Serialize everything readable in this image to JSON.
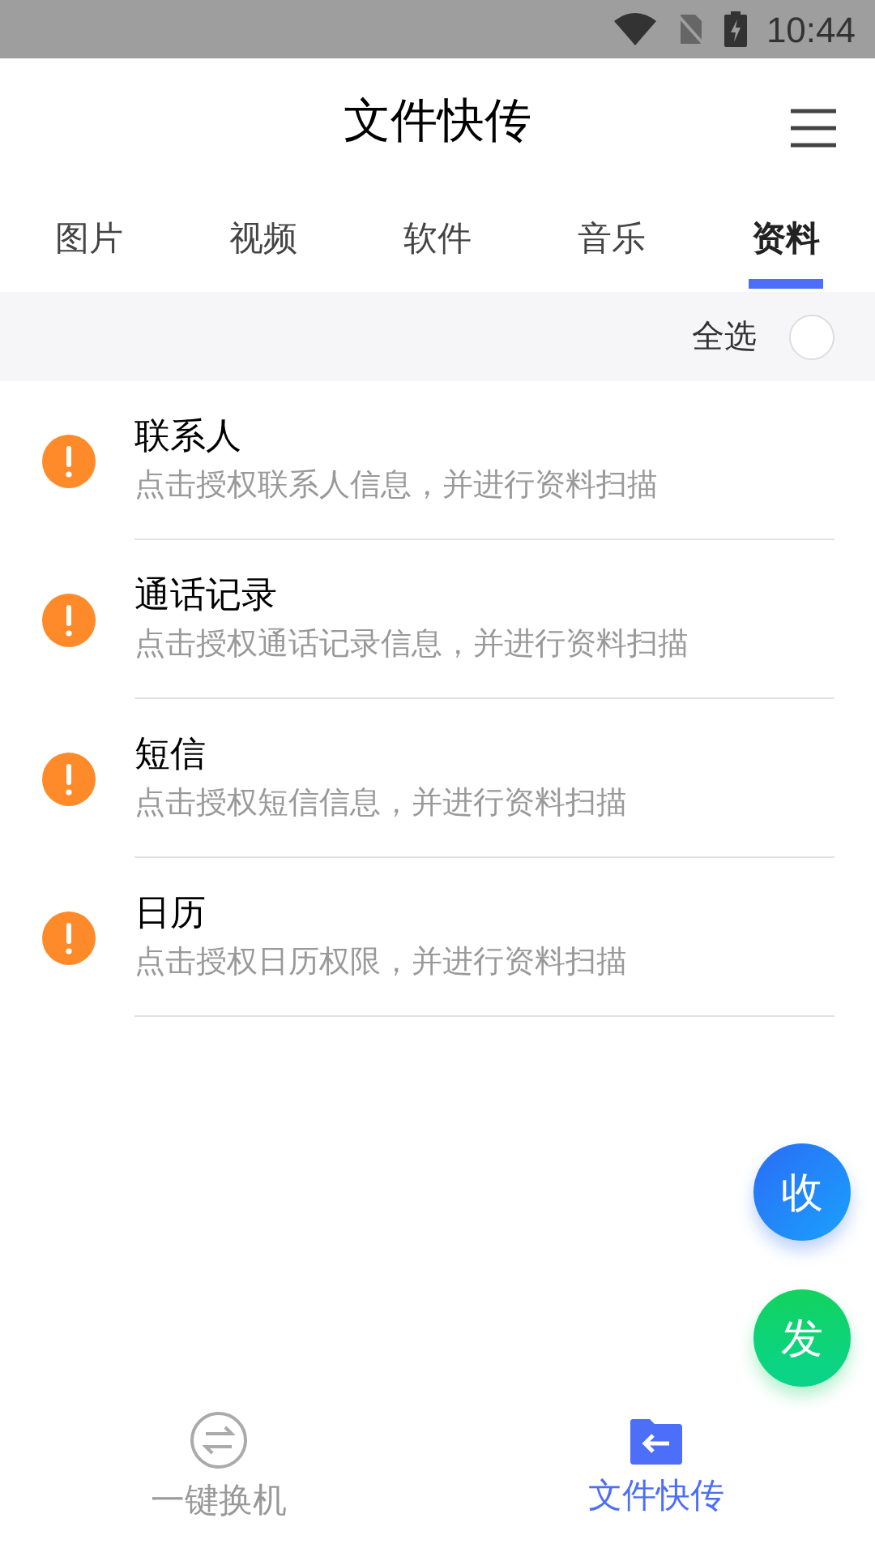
{
  "status_bar": {
    "time": "10:44"
  },
  "header": {
    "title": "文件快传"
  },
  "tabs": [
    {
      "label": "图片",
      "selected": false
    },
    {
      "label": "视频",
      "selected": false
    },
    {
      "label": "软件",
      "selected": false
    },
    {
      "label": "音乐",
      "selected": false
    },
    {
      "label": "资料",
      "selected": true
    }
  ],
  "select_all": {
    "label": "全选",
    "checked": false
  },
  "items": [
    {
      "title": "联系人",
      "subtitle": "点击授权联系人信息，并进行资料扫描"
    },
    {
      "title": "通话记录",
      "subtitle": "点击授权通话记录信息，并进行资料扫描"
    },
    {
      "title": "短信",
      "subtitle": "点击授权短信信息，并进行资料扫描"
    },
    {
      "title": "日历",
      "subtitle": "点击授权日历权限，并进行资料扫描"
    }
  ],
  "fabs": [
    {
      "label": "收",
      "kind": "receive"
    },
    {
      "label": "发",
      "kind": "send"
    }
  ],
  "bottom_nav": [
    {
      "label": "一键换机",
      "kind": "switch",
      "selected": false
    },
    {
      "label": "文件快传",
      "kind": "folder",
      "selected": true
    }
  ]
}
